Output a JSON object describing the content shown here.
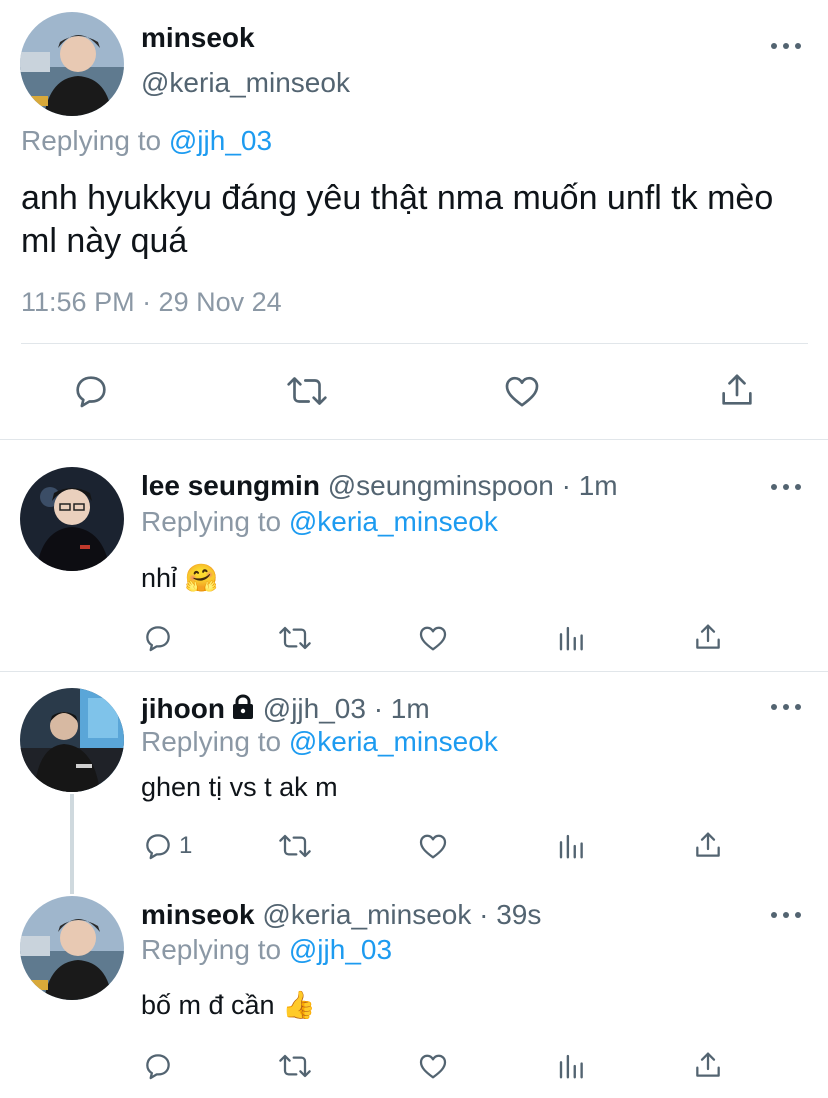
{
  "main_tweet": {
    "name": "minseok",
    "handle": "@keria_minseok",
    "replying_prefix": "Replying to",
    "replying_to": "@jjh_03",
    "text": "anh hyukkyu đáng yêu thật nma muốn unfl tk mèo ml này quá",
    "timestamp": "11:56 PM · 29 Nov 24",
    "actions": [
      "reply-icon",
      "retweet-icon",
      "like-icon",
      "share-icon"
    ]
  },
  "replies": [
    {
      "name": "lee seungmin",
      "handle_time": "@seungminspoon · 1m",
      "replying_prefix": "Replying to",
      "replying_to": "@keria_minseok",
      "text": "nhỉ",
      "emoji": "🤗",
      "reply_count": ""
    },
    {
      "name": "jihoon",
      "handle_time": "@jjh_03 · 1m",
      "replying_prefix": "Replying to",
      "replying_to": "@keria_minseok",
      "text": "ghen tị vs t ak m",
      "emoji": "",
      "reply_count": "1"
    },
    {
      "name": "minseok",
      "handle_time": "@keria_minseok · 39s",
      "replying_prefix": "Replying to",
      "replying_to": "@jjh_03",
      "text": "bố m đ cần",
      "emoji": "👍",
      "reply_count": ""
    }
  ],
  "colors": {
    "link": "#1d9bf0",
    "secondary_text": "#536471",
    "muted_text": "#8b98a5",
    "divider": "#e1e6ea",
    "thread_line": "#cfd9de"
  }
}
